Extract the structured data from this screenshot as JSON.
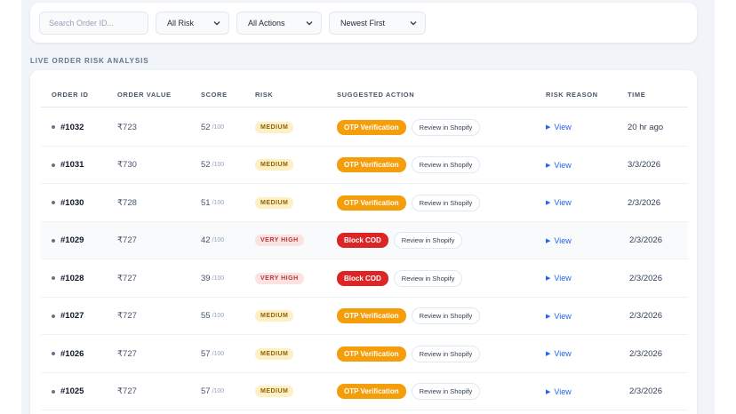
{
  "filters": {
    "search_placeholder": "Search Order ID...",
    "risk_select": "All Risk",
    "actions_select": "All Actions",
    "sort_select": "Newest First"
  },
  "section": {
    "title": "LIVE ORDER RISK ANALYSIS"
  },
  "table": {
    "headers": {
      "order_id": "ORDER ID",
      "order_value": "ORDER VALUE",
      "score": "SCORE",
      "risk": "RISK",
      "action": "SUGGESTED ACTION",
      "reason": "RISK REASON",
      "time": "TIME"
    },
    "score_max": "/100",
    "view_label": "View",
    "shopify_label": "Review in Shopify",
    "rows": [
      {
        "id": "#1032",
        "value": "₹723",
        "score": "52",
        "risk": "MEDIUM",
        "risk_level": "medium",
        "action": "OTP Verification",
        "action_type": "otp",
        "time": "20 hr ago"
      },
      {
        "id": "#1031",
        "value": "₹730",
        "score": "52",
        "risk": "MEDIUM",
        "risk_level": "medium",
        "action": "OTP Verification",
        "action_type": "otp",
        "time": "3/3/2026"
      },
      {
        "id": "#1030",
        "value": "₹728",
        "score": "51",
        "risk": "MEDIUM",
        "risk_level": "medium",
        "action": "OTP Verification",
        "action_type": "otp",
        "time": "2/3/2026"
      },
      {
        "id": "#1029",
        "value": "₹727",
        "score": "42",
        "risk": "VERY HIGH",
        "risk_level": "veryhigh",
        "action": "Block COD",
        "action_type": "block",
        "time": "2/3/2026"
      },
      {
        "id": "#1028",
        "value": "₹727",
        "score": "39",
        "risk": "VERY HIGH",
        "risk_level": "veryhigh",
        "action": "Block COD",
        "action_type": "block",
        "time": "2/3/2026"
      },
      {
        "id": "#1027",
        "value": "₹727",
        "score": "55",
        "risk": "MEDIUM",
        "risk_level": "medium",
        "action": "OTP Verification",
        "action_type": "otp",
        "time": "2/3/2026"
      },
      {
        "id": "#1026",
        "value": "₹727",
        "score": "57",
        "risk": "MEDIUM",
        "risk_level": "medium",
        "action": "OTP Verification",
        "action_type": "otp",
        "time": "2/3/2026"
      },
      {
        "id": "#1025",
        "value": "₹727",
        "score": "57",
        "risk": "MEDIUM",
        "risk_level": "medium",
        "action": "OTP Verification",
        "action_type": "otp",
        "time": "2/3/2026"
      }
    ]
  }
}
